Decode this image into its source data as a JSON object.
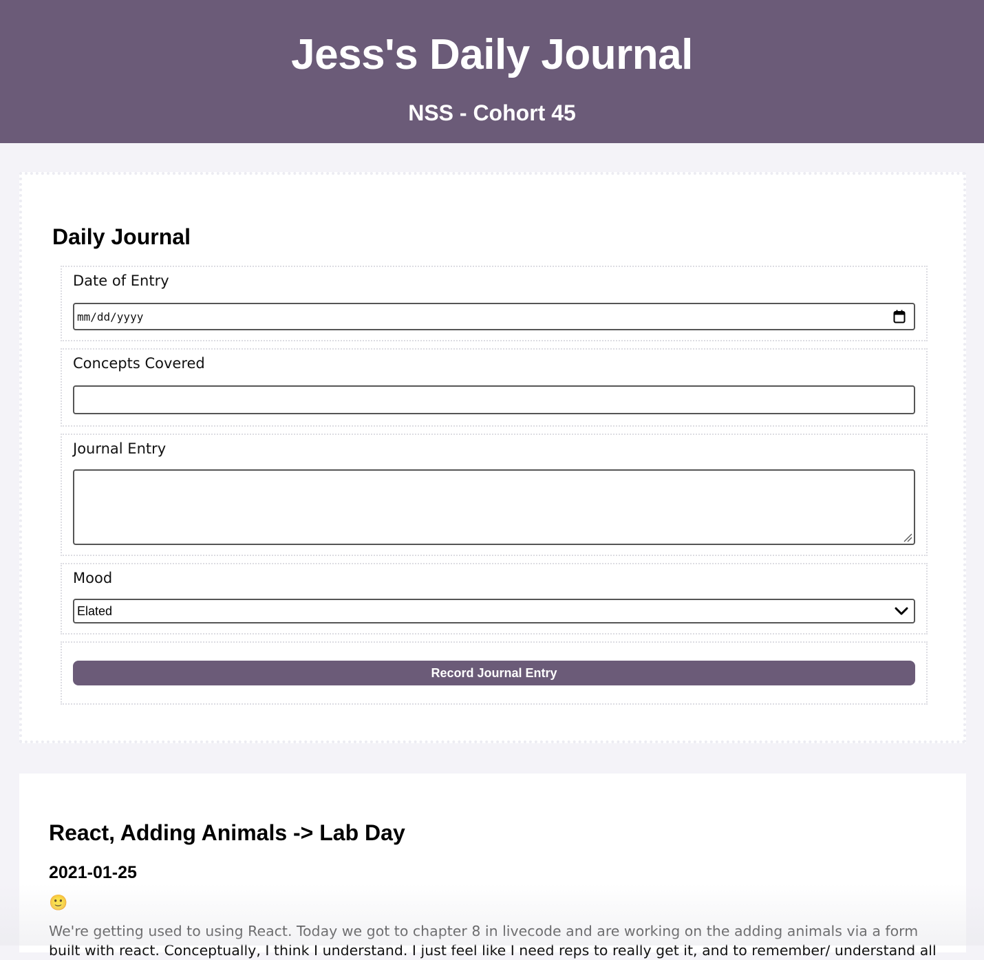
{
  "header": {
    "title": "Jess's Daily Journal",
    "subtitle": "NSS - Cohort 45"
  },
  "form": {
    "title": "Daily Journal",
    "date_label": "Date of Entry",
    "date_placeholder": "mm/dd/yyyy",
    "concepts_label": "Concepts Covered",
    "concepts_value": "",
    "entry_label": "Journal Entry",
    "entry_value": "",
    "mood_label": "Mood",
    "mood_selected": "Elated",
    "submit_label": "Record Journal Entry",
    "icons": [
      "calendar-icon",
      "chevron-down-icon",
      "resize-handle-icon"
    ]
  },
  "entries": [
    {
      "concept": "React, Adding Animals -> Lab Day",
      "date": "2021-01-25",
      "mood_emoji": "🙂",
      "text": "We're getting used to using React. Today we got to chapter 8 in livecode and are working on the adding animals via a form built with react. Conceptually, I think I understand. I just feel like I need reps to really get it, and to remember/ understand all"
    }
  ],
  "colors": {
    "accent": "#6b5b78",
    "page_background": "#f4f3f8",
    "card_background": "#ffffff"
  }
}
